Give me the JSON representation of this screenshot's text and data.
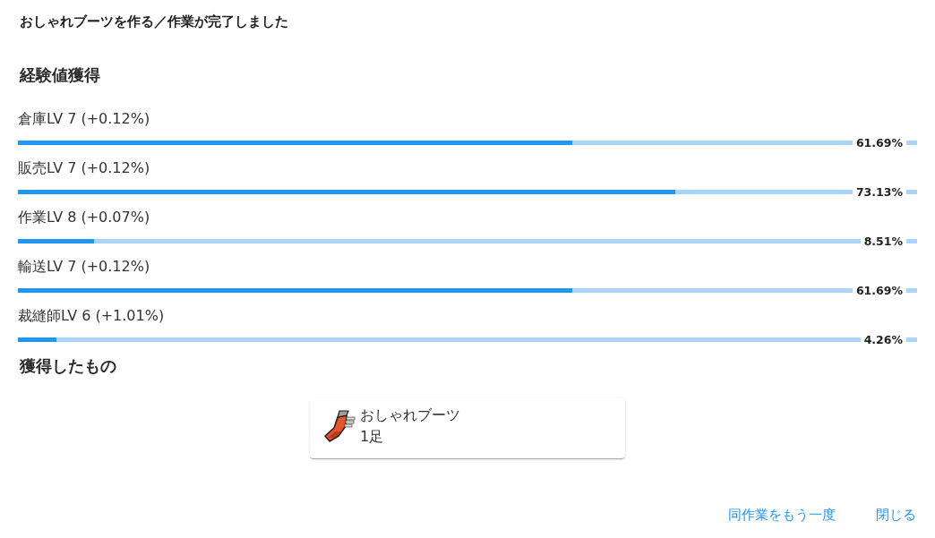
{
  "dialog": {
    "title": "おしゃれブーツを作る／作業が完了しました"
  },
  "experience": {
    "heading": "経験値獲得",
    "skills": [
      {
        "label": "倉庫LV 7 (+0.12%)",
        "level": 0.6169,
        "reading": "61.69%"
      },
      {
        "label": "販売LV 7 (+0.12%)",
        "level": 0.7313,
        "reading": "73.13%"
      },
      {
        "label": "作業LV 8 (+0.07%)",
        "level": 0.0851,
        "reading": "8.51%"
      },
      {
        "label": "輸送LV 7 (+0.12%)",
        "level": 0.6169,
        "reading": "61.69%"
      },
      {
        "label": "裁縫師LV 6 (+1.01%)",
        "level": 0.0426,
        "reading": "4.26%"
      }
    ]
  },
  "obtained": {
    "heading": "獲得したもの",
    "items": [
      {
        "name": "おしゃれブーツ",
        "quantity": "1足"
      }
    ]
  },
  "actions": [
    {
      "label": "同作業をもう一度"
    },
    {
      "label": "閉じる"
    }
  ]
}
